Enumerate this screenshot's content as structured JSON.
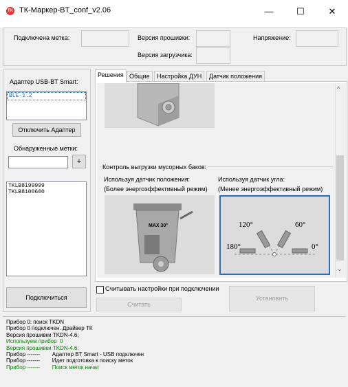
{
  "window": {
    "title": "ТК-Маркер-BT_conf_v2.06",
    "icon": "app-icon",
    "minimize": "—",
    "maximize": "☐",
    "close": "✕"
  },
  "header": {
    "connected_tag_label": "Подключена метка:",
    "firmware_label": "Версия прошивки:",
    "bootloader_label": "Версия загрузчика:",
    "voltage_label": "Напряжение:",
    "connected_tag_value": "",
    "firmware_value": "",
    "bootloader_value": "",
    "voltage_value": ""
  },
  "sidebar": {
    "adapter_label": "Адаптер USB-BT Smart:",
    "adapters": [
      "BLE-1.2"
    ],
    "disconnect_button": "Отключить Адаптер",
    "found_tags_label": "Обнаруженные метки:",
    "tag_filter_value": "",
    "add_button": "+",
    "tags": [
      "TKLB8199999",
      "TKLB8100600"
    ],
    "connect_button": "Подключиться"
  },
  "tabs": [
    {
      "label": "Решения",
      "active": true
    },
    {
      "label": "Общие",
      "active": false
    },
    {
      "label": "Настройка ДУН",
      "active": false
    },
    {
      "label": "Датчик положения",
      "active": false
    }
  ],
  "solutions": {
    "group_title": "Контроль выгрузки мусорных баков:",
    "position_option": "Используя датчик положения:",
    "position_note": "(Более энергоэффективный режим)",
    "angle_option": "Используя датчик угла:",
    "angle_note": "(Менее энергоэффективный режим)",
    "bin_label": "MAX 30°",
    "angle_labels": {
      "a120": "120°",
      "a60": "60°",
      "a180": "180°",
      "a0": "0°"
    }
  },
  "footer": {
    "read_on_connect": "Считывать настройки при подключении",
    "read_on_connect_checked": false,
    "read_button": "Считать",
    "install_button": "Установить"
  },
  "log": [
    {
      "text": "Прибор 0: поиск TKDN",
      "color": "#000000"
    },
    {
      "text": "Прибор 0 подключен. Драйвер ТК",
      "color": "#000000"
    },
    {
      "text": "Версия прошивки TKDN-4.6;",
      "color": "#000000"
    },
    {
      "text": "Используем прибор  0",
      "color": "#008000"
    },
    {
      "text": "Версия прошивки TKDN-4.6;",
      "color": "#008000"
    },
    {
      "text": "Прибор -------        Адаптер BT Smart - USB подключен",
      "color": "#000000"
    },
    {
      "text": "Прибор -------        Идет подготовка к поиску меток",
      "color": "#000000"
    },
    {
      "text": "Прибор -------        Поиск меток начат",
      "color": "#008000"
    }
  ],
  "colors": {
    "accent": "#2a6ebb",
    "log_green": "#008000"
  }
}
